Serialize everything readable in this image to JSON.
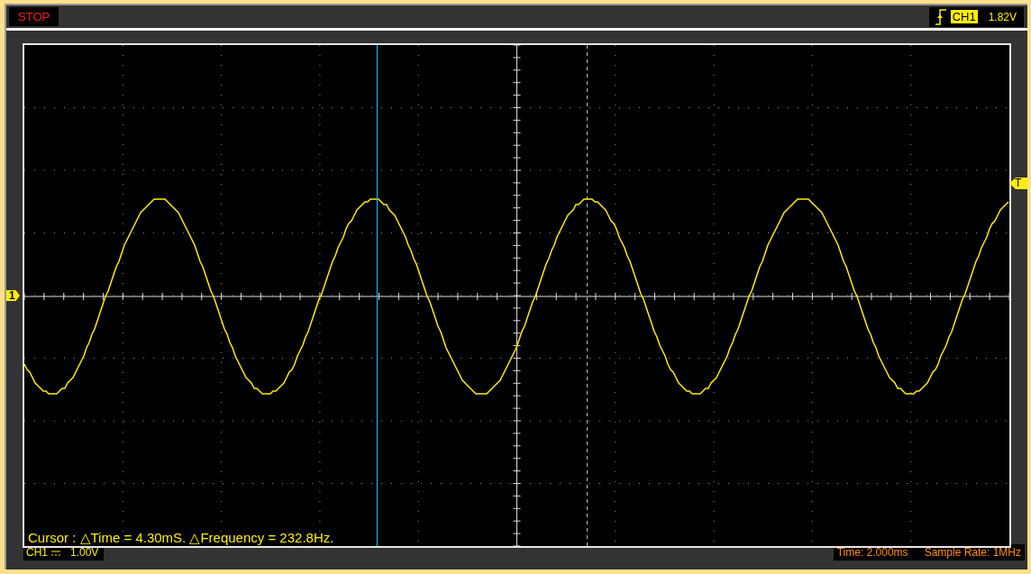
{
  "status": {
    "label": "STOP"
  },
  "trigger": {
    "channel": "CH1",
    "level": "1.82V"
  },
  "display": {
    "cursor_readout": "Cursor : △Time = 4.30mS. △Frequency = 232.8Hz.",
    "channel_marker": "1",
    "trigger_marker": "T"
  },
  "bottom_bar": {
    "channel": "CH1",
    "volts_per_div": "1.00V",
    "time_base": "Time: 2.000ms",
    "sample_rate": "Sample Rate: 1MHz"
  }
}
